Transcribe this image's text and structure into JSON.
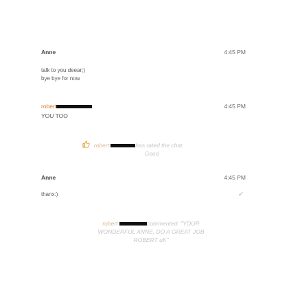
{
  "chat": {
    "messages": [
      {
        "sender": "Anne",
        "time": "4:45 PM",
        "lines": [
          "talk to you deear;)",
          "bye bye for now"
        ]
      },
      {
        "sender": "robert",
        "time": "4:45 PM",
        "lines": [
          "YOU TOO"
        ]
      },
      {
        "sender": "Anne",
        "time": "4:45 PM",
        "lines": [
          "thanx:)"
        ]
      }
    ],
    "rating_event": {
      "icon": "thumbs-up-icon",
      "name": "robert",
      "action": "has rated the chat",
      "rating": "Good"
    },
    "comment_event": {
      "name": "robert",
      "text_line1": "commented: \"YOUR",
      "text_line2": "WONDERFUL ANNE. DO A GREAT JOB",
      "text_line3": "ROBERT uK\""
    }
  },
  "colors": {
    "visitor_name": "#d87a2a",
    "system_text": "#c7c7c7",
    "redaction": "#111111"
  }
}
